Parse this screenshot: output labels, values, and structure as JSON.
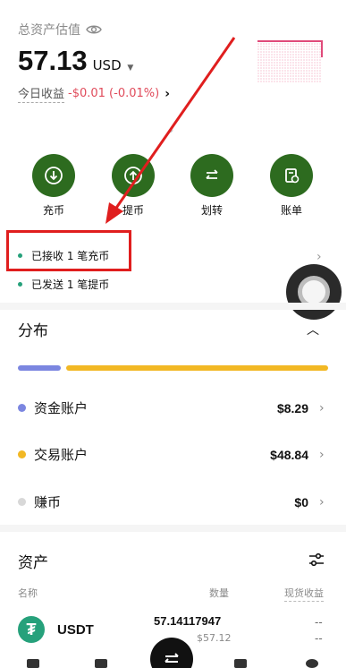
{
  "header": {
    "title": "总资产估值",
    "eye_icon": "eye-icon",
    "balance": "57.13",
    "currency": "USD",
    "pnl_label": "今日收益",
    "pnl_value": "-$0.01 (-0.01%)",
    "pnl_chevron": "›"
  },
  "actions": [
    {
      "label": "充币",
      "icon": "deposit-icon"
    },
    {
      "label": "提币",
      "icon": "withdraw-icon"
    },
    {
      "label": "划转",
      "icon": "transfer-icon"
    },
    {
      "label": "账单",
      "icon": "bill-icon"
    }
  ],
  "notifications": [
    {
      "text": "已接收 1 笔充币"
    },
    {
      "text": "已发送 1 笔提币"
    }
  ],
  "distribution": {
    "title": "分布",
    "collapse_icon": "chevron-up-icon",
    "bar": {
      "funding_fraction": 0.14,
      "trading_fraction": 0.86
    },
    "rows": [
      {
        "name": "资金账户",
        "value": "$8.29",
        "color": "#7b86e0"
      },
      {
        "name": "交易账户",
        "value": "$48.84",
        "color": "#f2b824"
      },
      {
        "name": "赚币",
        "value": "$0",
        "color": "#d8d8d8"
      }
    ]
  },
  "assets": {
    "title": "资产",
    "filter_icon": "sliders-icon",
    "columns": {
      "name": "名称",
      "amount": "数量",
      "pnl": "现货收益"
    },
    "rows": [
      {
        "symbol": "USDT",
        "logo": "₮",
        "amount": "57.14117947",
        "usd": "$57.12",
        "pnl_1": "--",
        "pnl_2": "--"
      }
    ]
  },
  "colors": {
    "accent_green": "#2d6b1f",
    "negative_red": "#e04a5a",
    "annotation_red": "#e01e1e"
  }
}
